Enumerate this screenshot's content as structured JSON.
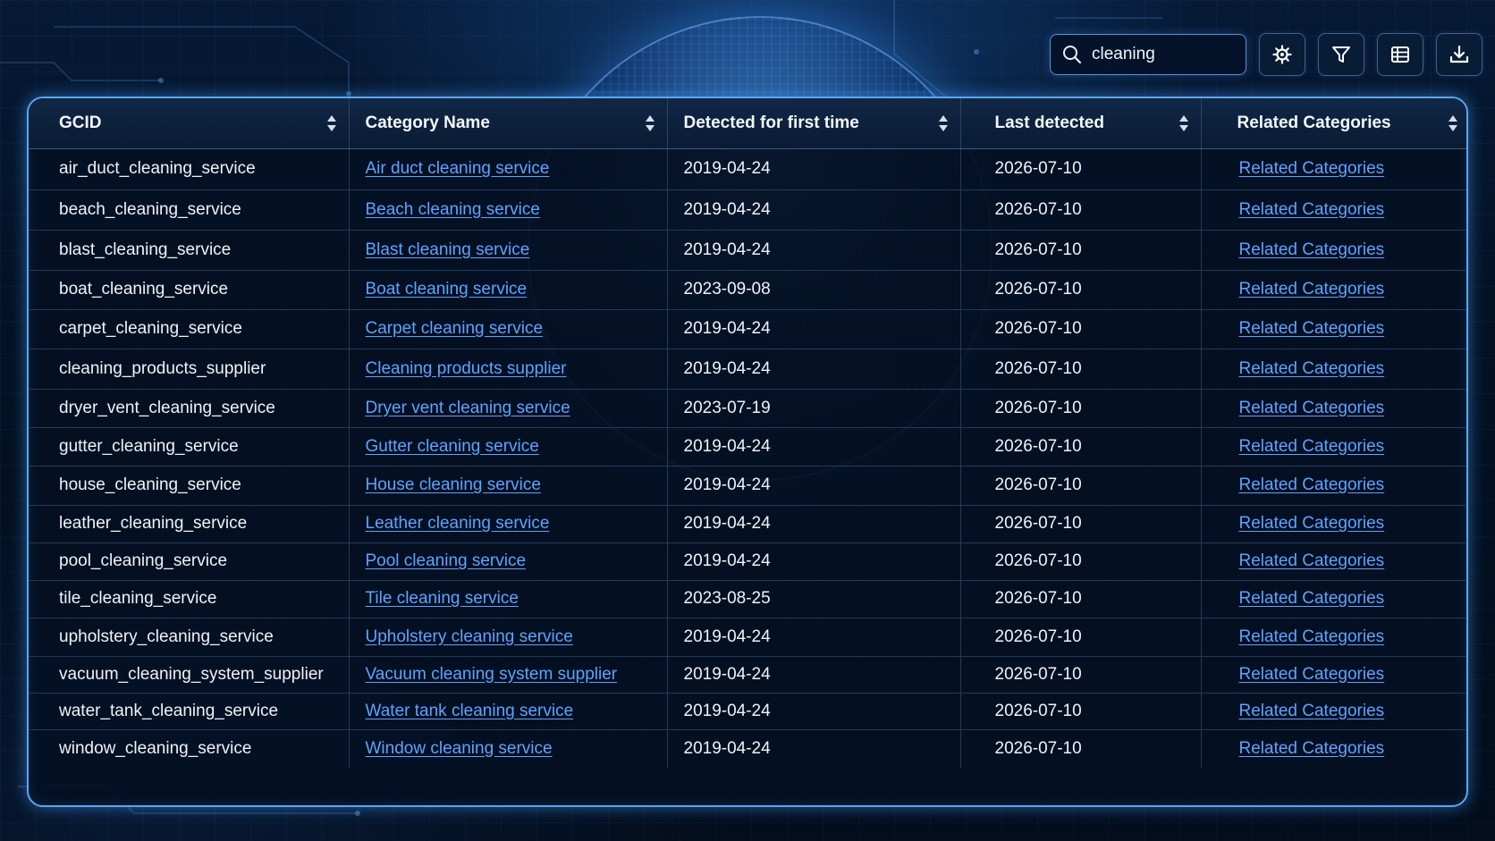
{
  "search": {
    "value": "cleaning",
    "icon": "search-icon"
  },
  "toolbar": {
    "buttons": [
      {
        "icon": "gear-icon"
      },
      {
        "icon": "filter-icon"
      },
      {
        "icon": "columns-icon"
      },
      {
        "icon": "download-icon"
      }
    ]
  },
  "table": {
    "columns": [
      "GCID",
      "Category Name",
      "Detected for first time",
      "Last detected",
      "Related Categories"
    ],
    "rows": [
      {
        "gcid": "air_duct_cleaning_service",
        "name": "Air duct cleaning service",
        "first": "2019-04-24",
        "last": "2026-07-10",
        "related": "Related Categories"
      },
      {
        "gcid": "beach_cleaning_service",
        "name": "Beach cleaning service",
        "first": "2019-04-24",
        "last": "2026-07-10",
        "related": "Related Categories"
      },
      {
        "gcid": "blast_cleaning_service",
        "name": "Blast cleaning service",
        "first": "2019-04-24",
        "last": "2026-07-10",
        "related": "Related Categories"
      },
      {
        "gcid": "boat_cleaning_service",
        "name": "Boat cleaning service",
        "first": "2023-09-08",
        "last": "2026-07-10",
        "related": "Related Categories"
      },
      {
        "gcid": "carpet_cleaning_service",
        "name": "Carpet cleaning service",
        "first": "2019-04-24",
        "last": "2026-07-10",
        "related": "Related Categories"
      },
      {
        "gcid": "cleaning_products_supplier",
        "name": "Cleaning products supplier",
        "first": "2019-04-24",
        "last": "2026-07-10",
        "related": "Related Categories"
      },
      {
        "gcid": "dryer_vent_cleaning_service",
        "name": "Dryer vent cleaning service",
        "first": "2023-07-19",
        "last": "2026-07-10",
        "related": "Related Categories"
      },
      {
        "gcid": "gutter_cleaning_service",
        "name": "Gutter cleaning service",
        "first": "2019-04-24",
        "last": "2026-07-10",
        "related": "Related Categories"
      },
      {
        "gcid": "house_cleaning_service",
        "name": "House cleaning service",
        "first": "2019-04-24",
        "last": "2026-07-10",
        "related": "Related Categories"
      },
      {
        "gcid": "leather_cleaning_service",
        "name": "Leather cleaning service",
        "first": "2019-04-24",
        "last": "2026-07-10",
        "related": "Related Categories"
      },
      {
        "gcid": "pool_cleaning_service",
        "name": "Pool cleaning service",
        "first": "2019-04-24",
        "last": "2026-07-10",
        "related": "Related Categories"
      },
      {
        "gcid": "tile_cleaning_service",
        "name": "Tile cleaning service",
        "first": "2023-08-25",
        "last": "2026-07-10",
        "related": "Related Categories"
      },
      {
        "gcid": "upholstery_cleaning_service",
        "name": "Upholstery cleaning service",
        "first": "2019-04-24",
        "last": "2026-07-10",
        "related": "Related Categories"
      },
      {
        "gcid": "vacuum_cleaning_system_supplier",
        "name": "Vacuum cleaning system supplier",
        "first": "2019-04-24",
        "last": "2026-07-10",
        "related": "Related Categories"
      },
      {
        "gcid": "water_tank_cleaning_service",
        "name": "Water tank cleaning service",
        "first": "2019-04-24",
        "last": "2026-07-10",
        "related": "Related Categories"
      },
      {
        "gcid": "window_cleaning_service",
        "name": "Window cleaning service",
        "first": "2019-04-24",
        "last": "2026-07-10",
        "related": "Related Categories"
      }
    ]
  },
  "colors": {
    "accent": "#5aa6f0",
    "link": "#5ea3ff",
    "background": "#030e1f"
  }
}
